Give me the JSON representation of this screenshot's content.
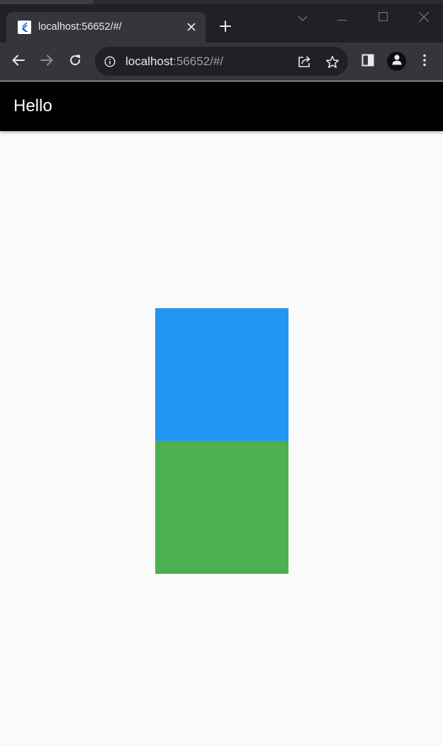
{
  "browser": {
    "tab": {
      "title": "localhost:56652/#/",
      "favicon": "flutter-logo-icon"
    },
    "address_bar": {
      "host": "localhost",
      "path": ":56652/#/"
    },
    "icons": {
      "back": "arrow-left-icon",
      "forward": "arrow-right-icon",
      "reload": "reload-icon",
      "info": "info-icon",
      "share": "share-icon",
      "bookmark": "star-icon",
      "side_panel": "side-panel-icon",
      "profile": "person-icon",
      "menu": "kebab-menu-icon",
      "new_tab": "plus-icon",
      "close_tab": "close-icon",
      "tab_search": "chevron-down-icon",
      "minimize": "minimize-icon",
      "maximize": "maximize-icon",
      "close_window": "close-icon"
    }
  },
  "app": {
    "app_bar": {
      "title": "Hello",
      "background": "#000000"
    },
    "boxes": [
      {
        "color": "#2196F3"
      },
      {
        "color": "#4CAF50"
      }
    ],
    "background": "#FAFAFA"
  }
}
